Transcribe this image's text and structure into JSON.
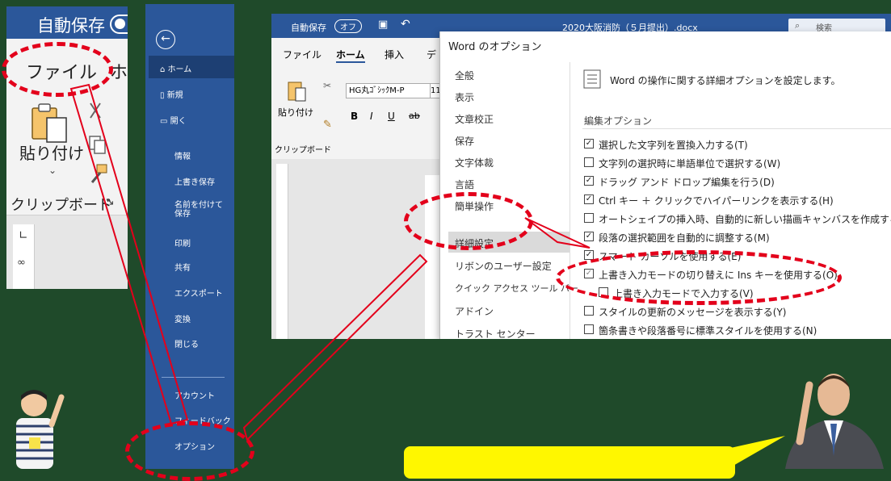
{
  "panel1": {
    "title": "自動保存",
    "file_tab": "ファイル",
    "home_tab": "ホ",
    "paste_label": "貼り付け",
    "clipboard_label": "クリップボード",
    "ruler_mark": "∞"
  },
  "backstage": {
    "back": "←",
    "items": [
      {
        "label": "ホーム",
        "icon": "home-icon",
        "glyph": "⌂",
        "selected": true
      },
      {
        "label": "新規",
        "icon": "new-doc-icon",
        "glyph": "▯"
      },
      {
        "label": "開く",
        "icon": "folder-icon",
        "glyph": "▭"
      },
      {
        "label": "情報"
      },
      {
        "label": "上書き保存"
      },
      {
        "label": "名前を付けて保存"
      },
      {
        "label": "印刷"
      },
      {
        "label": "共有"
      },
      {
        "label": "エクスポート"
      },
      {
        "label": "変換"
      },
      {
        "label": "閉じる"
      },
      {
        "label": "アカウント"
      },
      {
        "label": "フィードバック"
      },
      {
        "label": "オプション"
      }
    ]
  },
  "word": {
    "autosave_label": "自動保存",
    "autosave_state": "オフ",
    "doc_title": "2020大阪消防（５月提出）.docx",
    "search_placeholder": "検索",
    "tabs": [
      "ファイル",
      "ホーム",
      "挿入",
      "デ"
    ],
    "paste_label": "貼り付け",
    "font_name": "HG丸ｺﾞｼｯｸM-P",
    "font_size": "11",
    "clipboard_label": "クリップボード",
    "format_buttons": [
      "B",
      "I",
      "U",
      "ab"
    ]
  },
  "dialog": {
    "title": "Word のオプション",
    "nav": [
      "全般",
      "表示",
      "文章校正",
      "保存",
      "文字体裁",
      "言語",
      "簡単操作",
      "詳細設定",
      "リボンのユーザー設定",
      "クイック アクセス ツール バー",
      "アドイン",
      "トラスト センター"
    ],
    "selected_nav": "詳細設定",
    "header": "Word の操作に関する詳細オプションを設定します。",
    "section": "編集オプション",
    "options": [
      {
        "label": "選択した文字列を置換入力する(T)",
        "checked": true
      },
      {
        "label": "文字列の選択時に単語単位で選択する(W)",
        "checked": false
      },
      {
        "label": "ドラッグ アンド ドロップ編集を行う(D)",
        "checked": true
      },
      {
        "label": "Ctrl キー ＋ クリックでハイパーリンクを表示する(H)",
        "checked": true
      },
      {
        "label": "オートシェイプの挿入時、自動的に新しい描画キャンバスを作成する(A)",
        "checked": false
      },
      {
        "label": "段落の選択範囲を自動的に調整する(M)",
        "checked": true
      },
      {
        "label": "スマート カーソルを使用する(E)",
        "checked": true
      },
      {
        "label": "上書き入力モードの切り替えに Ins キーを使用する(O)",
        "checked": true
      },
      {
        "label": "上書き入力モードで入力する(V)",
        "checked": false
      },
      {
        "label": "スタイルの更新のメッセージを表示する(Y)",
        "checked": false
      },
      {
        "label": "箇条書きや段落番号に標準スタイルを使用する(N)",
        "checked": false
      }
    ]
  }
}
